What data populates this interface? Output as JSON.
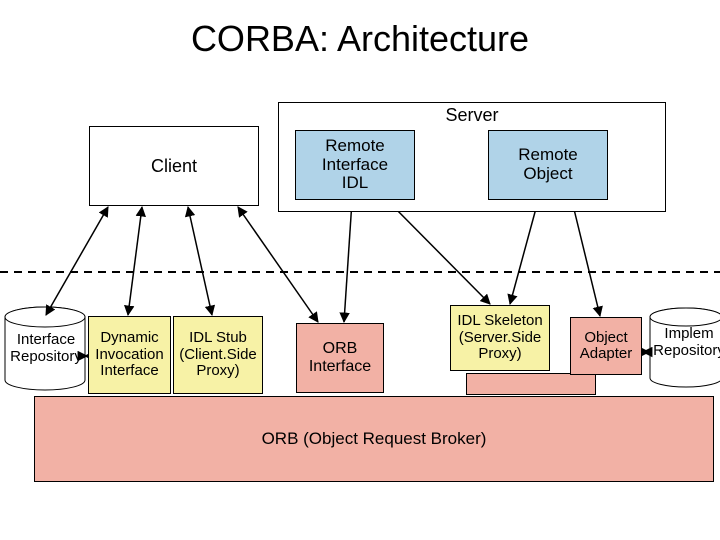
{
  "title": "CORBA: Architecture",
  "top": {
    "server_label": "Server",
    "client": "Client",
    "remote_idl": "Remote\nInterface\nIDL",
    "remote_obj": "Remote\nObject"
  },
  "mid": {
    "interface_repo": "Interface\nRepository",
    "dyn_inv": "Dynamic\nInvocation\nInterface",
    "idl_stub": "IDL Stub\n(Client.Side\nProxy)",
    "orb_if": "ORB\nInterface",
    "idl_skel": "IDL Skeleton\n(Server.Side\nProxy)",
    "obj_adapter": "Object\nAdapter",
    "implem_repo": "Implem\nRepository"
  },
  "orb": "ORB (Object Request Broker)"
}
